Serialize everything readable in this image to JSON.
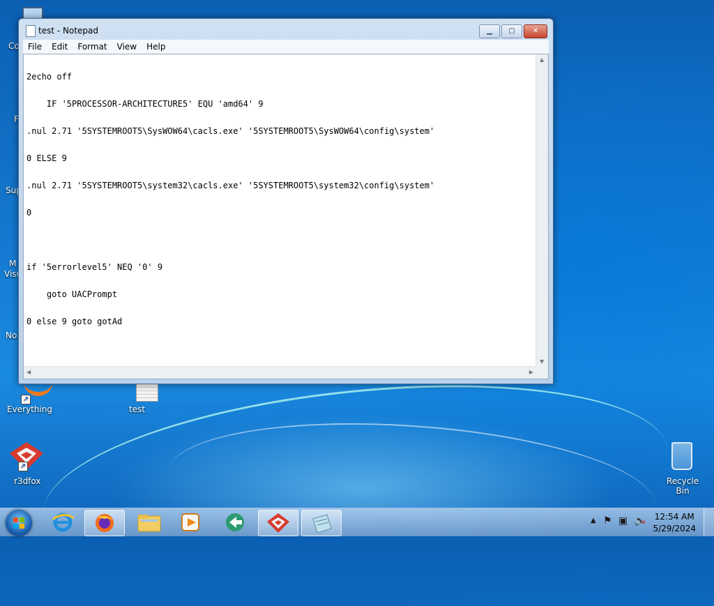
{
  "desktop": {
    "icons": [
      {
        "label": "Co"
      },
      {
        "label": "F"
      },
      {
        "label": "Sup"
      },
      {
        "label": "M"
      },
      {
        "label": "Visu"
      },
      {
        "label": "No"
      },
      {
        "label": "Everything"
      },
      {
        "label": "test"
      },
      {
        "label": "r3dfox"
      },
      {
        "label": "Recycle Bin"
      }
    ]
  },
  "window": {
    "title": "test - Notepad",
    "menu": [
      "File",
      "Edit",
      "Format",
      "View",
      "Help"
    ],
    "lines": [
      "2echo off",
      "    IF '5PROCESSOR-ARCHITECTURE5' EQU 'amd64' 9",
      ".nul 2.71 '5SYSTEMROOT5\\SysWOW64\\cacls.exe' '5SYSTEMROOT5\\SysWOW64\\config\\system'",
      "0 ELSE 9",
      ".nul 2.71 '5SYSTEMROOT5\\system32\\cacls.exe' '5SYSTEMROOT5\\system32\\config\\system'",
      "0",
      "",
      "if '5errorlevel5' NEQ '0' 9",
      "    goto UACPrompt",
      "0 else 9 goto gotAd"
    ]
  },
  "taskbar": {
    "time": "12:54 AM",
    "date": "5/29/2024"
  }
}
